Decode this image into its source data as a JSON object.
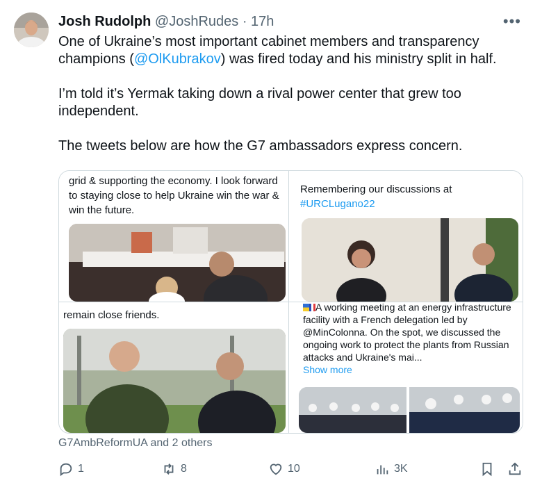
{
  "author": {
    "name": "Josh Rudolph",
    "handle": "@JoshRudes",
    "time": "· 17h"
  },
  "more_icon": "more-horizontal-icon",
  "text": {
    "p1_before": "One of Ukraine’s most important cabinet members and transparency champions (",
    "p1_mention": "@OlKubrakov",
    "p1_after": ") was fired today and his ministry split in half.",
    "p2": "I’m told it’s Yermak taking down a rival power center that grew too independent.",
    "p3": "The tweets below are how the G7 ambassadors express concern."
  },
  "quotes": {
    "q1": {
      "text": "grid & supporting the economy. I look forward to staying close to help Ukraine win the war & win the future."
    },
    "q2": {
      "text": "Remembering our discussions at",
      "hashtag": "#URCLugano22"
    },
    "q3": {
      "text": "remain close friends."
    },
    "q4": {
      "text": "A working meeting at an energy infrastructure facility with a French delegation led by @MinColonna. On the spot, we discussed the ongoing work to protect the plants from Russian attacks and Ukraine's mai...",
      "show_more": "Show more"
    }
  },
  "others": "G7AmbReformUA and 2 others",
  "actions": {
    "replies": "1",
    "retweets": "8",
    "likes": "10",
    "views": "3K"
  },
  "colors": {
    "link": "#1d9bf0",
    "muted": "#536471",
    "text": "#0f1419",
    "border": "#cfd9de"
  }
}
